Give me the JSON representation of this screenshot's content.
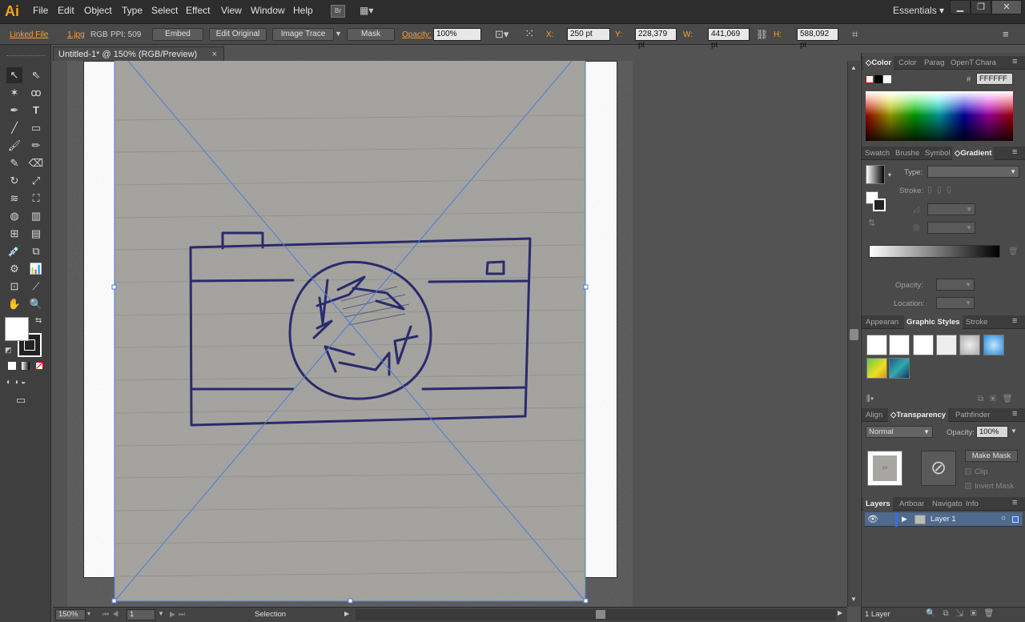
{
  "app": {
    "logo": "Ai",
    "workspace": "Essentials",
    "br": "Br"
  },
  "menu": [
    "File",
    "Edit",
    "Object",
    "Type",
    "Select",
    "Effect",
    "View",
    "Window",
    "Help"
  ],
  "control": {
    "linked_file": "Linked File",
    "filename": "1.jpg",
    "colormode": "RGB",
    "ppi": "PPI: 509",
    "embed": "Embed",
    "edit_original": "Edit Original",
    "image_trace": "Image Trace",
    "mask": "Mask",
    "opacity_label": "Opacity:",
    "opacity_value": "100%",
    "x_label": "X:",
    "x_value": "250 pt",
    "y_label": "Y:",
    "y_value": "228,379 pt",
    "w_label": "W:",
    "w_value": "441,069 pt",
    "h_label": "H:",
    "h_value": "588,092 pt"
  },
  "document": {
    "tab_title": "Untitled-1* @ 150% (RGB/Preview)",
    "close": "×"
  },
  "status": {
    "zoom": "150%",
    "page": "1",
    "tool": "Selection"
  },
  "color_panel": {
    "tabs": [
      "Color",
      "Color",
      "Parag",
      "OpenT",
      "Chara"
    ],
    "hex_label": "#",
    "hex": "FFFFFF"
  },
  "gradient_panel": {
    "tabs": [
      "Swatch",
      "Brushe",
      "Symbol",
      "Gradient"
    ],
    "type_label": "Type:",
    "stroke_label": "Stroke:",
    "opacity_label": "Opacity:",
    "location_label": "Location:"
  },
  "styles_panel": {
    "tabs": [
      "Appearan",
      "Graphic Styles",
      "Stroke"
    ]
  },
  "transparency_panel": {
    "tabs": [
      "Align",
      "Transparency",
      "Pathfinder"
    ],
    "blend_mode": "Normal",
    "opacity_label": "Opacity:",
    "opacity_value": "100%",
    "make_mask": "Make Mask",
    "clip": "Clip",
    "invert_mask": "Invert Mask"
  },
  "layers_panel": {
    "tabs": [
      "Layers",
      "Artboar",
      "Navigato",
      "Info"
    ],
    "layer_name": "Layer 1",
    "footer": "1 Layer"
  },
  "colors": {
    "accent": "#f7a21b",
    "selection": "#4f7bd8",
    "ink": "#2a2a6e"
  }
}
